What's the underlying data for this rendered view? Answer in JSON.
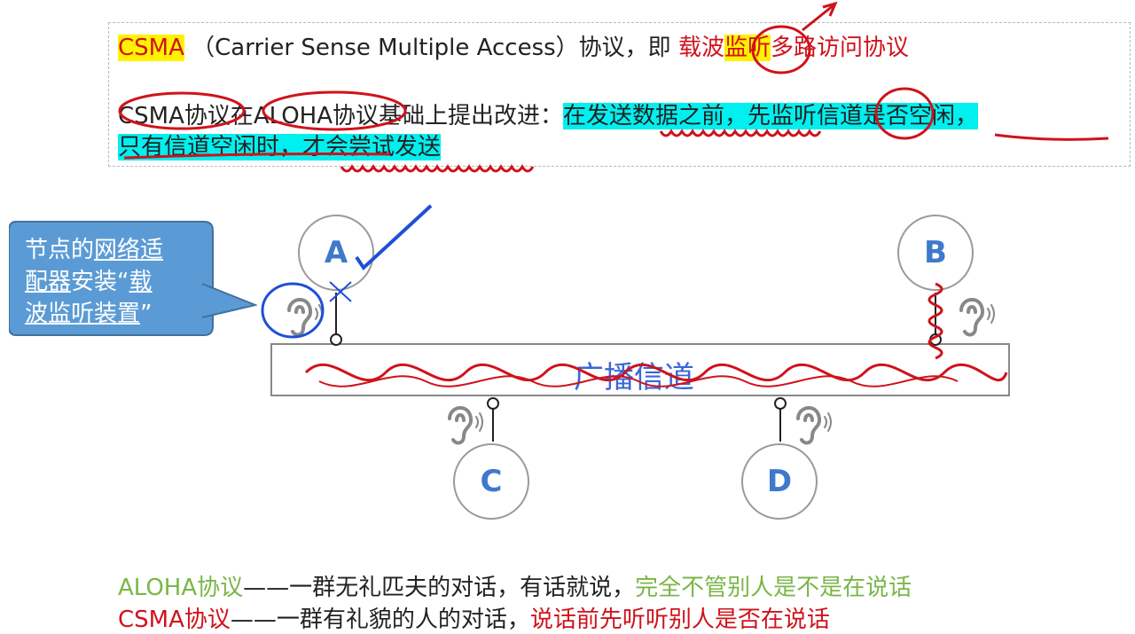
{
  "header": {
    "csma_abbr": "CSMA",
    "csma_full": "（Carrier Sense Multiple Access）协议，即",
    "csma_cn_1": "载波",
    "csma_cn_hl": "监听",
    "csma_cn_2": "多路访问协议",
    "intro": "CSMA协议在ALOHA协议基础上提出改进：",
    "improve_1": "在发送数据之前，先监听信道是否空闲，",
    "improve_2": "只有信道空闲时，才会尝试发送"
  },
  "callout": {
    "line1a": "节点的",
    "line1b": "网络适",
    "line2a": "配器",
    "line2b": "安装“",
    "line2c": "载",
    "line3a": "波监听装置",
    "line3b": "”"
  },
  "diagram": {
    "channel_label": "广播信道",
    "nodes": [
      "A",
      "B",
      "C",
      "D"
    ]
  },
  "footer": {
    "aloha_name": "ALOHA协议",
    "aloha_dash": "——一群无礼匹夫的对话，有话就说，",
    "aloha_note": "完全不管别人是不是在说话",
    "csma_name": "CSMA协议",
    "csma_dash": "——一群有礼貌的人的对话，",
    "csma_note": "说话前先听听别人是否在说话"
  },
  "colors": {
    "red": "#d0121b",
    "green": "#7ab648",
    "blue_node": "#3f79cc",
    "callout": "#5b9bd5"
  }
}
